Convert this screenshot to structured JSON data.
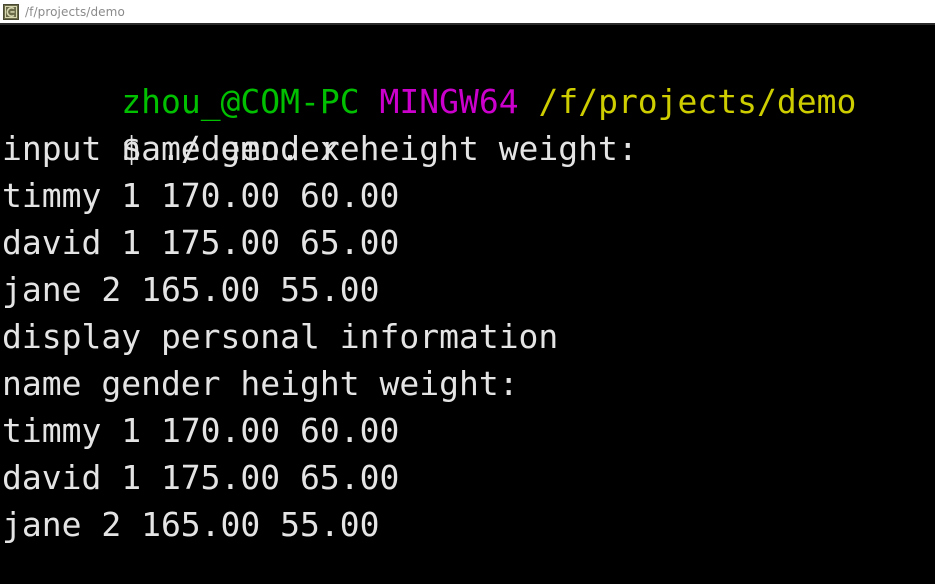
{
  "window": {
    "icon": "mingw-terminal-icon",
    "title": "/f/projects/demo",
    "icon_bg_color": "#6b6b4a",
    "icon_fg_color": "#d8d8b0"
  },
  "terminal": {
    "background_color": "#000000",
    "default_text_color": "#e4e4e4",
    "prompt_user_color": "#00c000",
    "prompt_shell_color": "#cc00cc",
    "prompt_path_color": "#cdcd00",
    "prompt": {
      "user_host": "zhou_@COM-PC",
      "shell": "MINGW64",
      "path": "/f/projects/demo",
      "sigil": "$",
      "command": "./demo.exe"
    },
    "lines": [
      {
        "id": "line-prompt",
        "type": "prompt"
      },
      {
        "id": "line-command",
        "type": "command"
      },
      {
        "id": "line-output-1",
        "type": "output",
        "text": "input name gender height weight:"
      },
      {
        "id": "line-output-2",
        "type": "output",
        "text": "timmy 1 170.00 60.00"
      },
      {
        "id": "line-output-3",
        "type": "output",
        "text": "david 1 175.00 65.00"
      },
      {
        "id": "line-output-4",
        "type": "output",
        "text": "jane 2 165.00 55.00"
      },
      {
        "id": "line-output-5",
        "type": "output",
        "text": "display personal information"
      },
      {
        "id": "line-output-6",
        "type": "output",
        "text": "name gender height weight:"
      },
      {
        "id": "line-output-7",
        "type": "output",
        "text": "timmy 1 170.00 60.00"
      },
      {
        "id": "line-output-8",
        "type": "output",
        "text": "david 1 175.00 65.00"
      },
      {
        "id": "line-output-9",
        "type": "output",
        "text": "jane 2 165.00 55.00"
      }
    ],
    "records": {
      "input_header": "input name gender height weight:",
      "display_header": "display personal information",
      "table_header": "name gender height weight:",
      "columns": [
        "name",
        "gender",
        "height",
        "weight"
      ],
      "rows": [
        {
          "name": "timmy",
          "gender": "1",
          "height": "170.00",
          "weight": "60.00"
        },
        {
          "name": "david",
          "gender": "1",
          "height": "175.00",
          "weight": "65.00"
        },
        {
          "name": "jane",
          "gender": "2",
          "height": "165.00",
          "weight": "55.00"
        }
      ]
    }
  }
}
